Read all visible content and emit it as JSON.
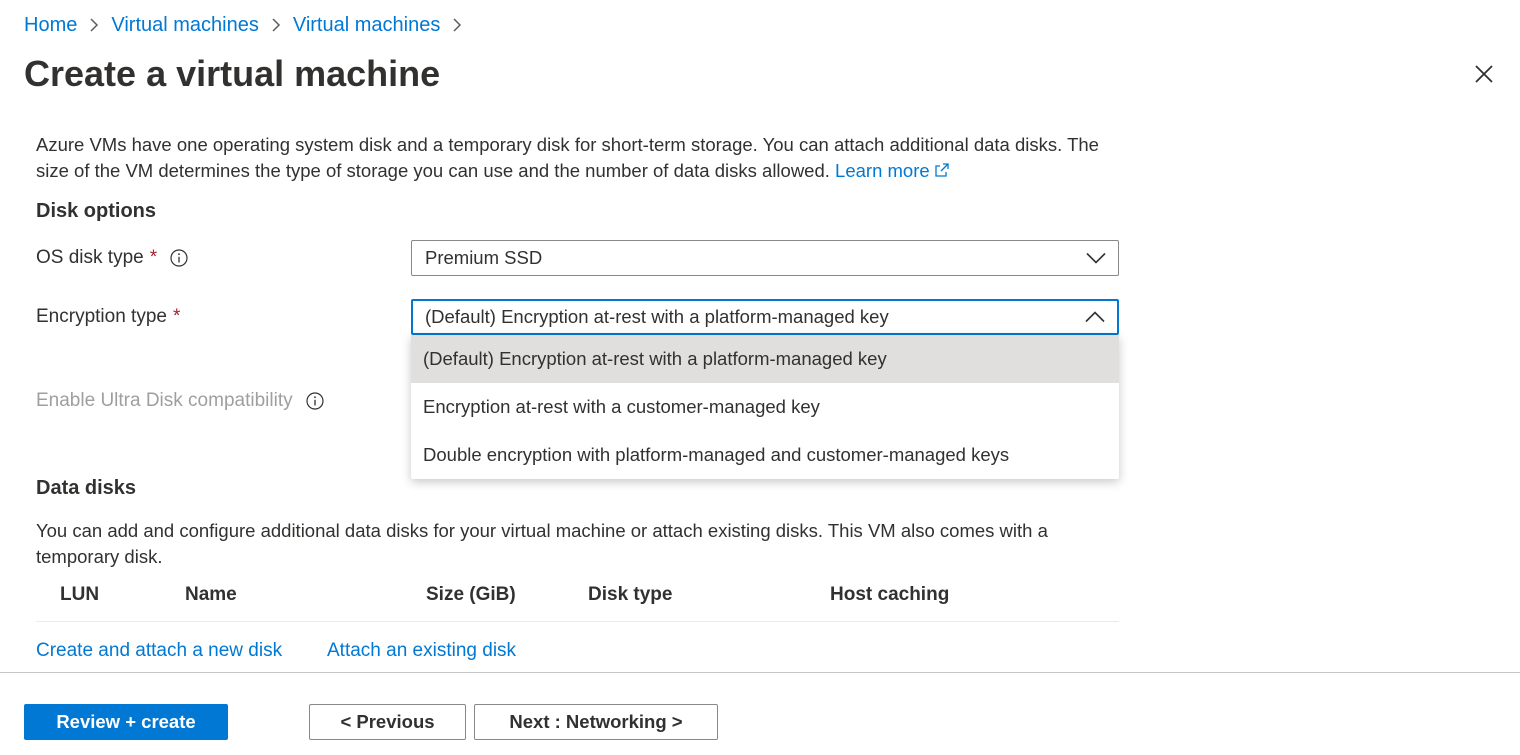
{
  "breadcrumb": {
    "items": [
      "Home",
      "Virtual machines",
      "Virtual machines"
    ]
  },
  "page": {
    "title": "Create a virtual machine"
  },
  "intro": {
    "text": "Azure VMs have one operating system disk and a temporary disk for short-term storage. You can attach additional data disks. The size of the VM determines the type of storage you can use and the number of data disks allowed.",
    "learn_more": "Learn more"
  },
  "disk_options": {
    "title": "Disk options",
    "os_disk_type": {
      "label": "OS disk type",
      "required_mark": "*",
      "value": "Premium SSD"
    },
    "encryption_type": {
      "label": "Encryption type",
      "required_mark": "*",
      "value": "(Default) Encryption at-rest with a platform-managed key",
      "options": [
        "(Default) Encryption at-rest with a platform-managed key",
        "Encryption at-rest with a customer-managed key",
        "Double encryption with platform-managed and customer-managed keys"
      ]
    },
    "ultra_disk": {
      "label": "Enable Ultra Disk compatibility"
    }
  },
  "data_disks": {
    "title": "Data disks",
    "description": "You can add and configure additional data disks for your virtual machine or attach existing disks. This VM also comes with a temporary disk.",
    "columns": [
      "LUN",
      "Name",
      "Size (GiB)",
      "Disk type",
      "Host caching"
    ],
    "create_link": "Create and attach a new disk",
    "attach_link": "Attach an existing disk"
  },
  "footer": {
    "review_create": "Review + create",
    "previous": "< Previous",
    "next": "Next : Networking >"
  },
  "colors": {
    "accent": "#0078d4",
    "required": "#a4262c",
    "selected_option_bg": "#e1dfdd"
  }
}
